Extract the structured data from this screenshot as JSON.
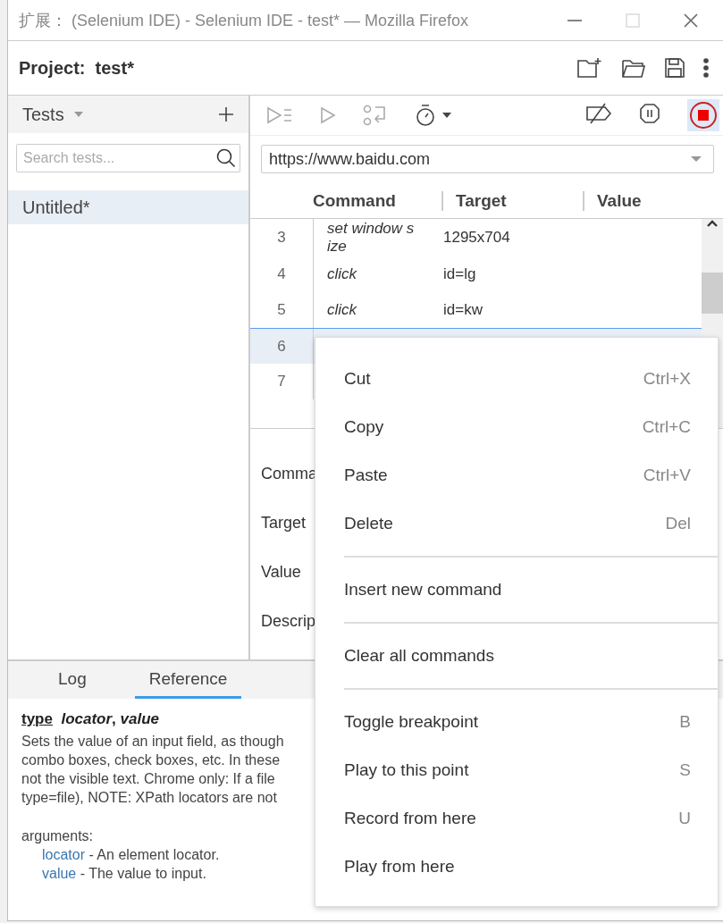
{
  "window": {
    "title": "扩展： (Selenium IDE) - Selenium IDE - test* — Mozilla Firefox"
  },
  "project": {
    "label": "Project:",
    "name": "test*"
  },
  "sidebar": {
    "title": "Tests",
    "search": {
      "placeholder": "Search tests..."
    },
    "items": [
      {
        "label": "Untitled*",
        "selected": true
      }
    ]
  },
  "url": {
    "value": "https://www.baidu.com"
  },
  "table": {
    "columns": [
      "Command",
      "Target",
      "Value"
    ],
    "rows": [
      {
        "index": "3",
        "command": "set window s ize",
        "target": "1295x704",
        "selected": false
      },
      {
        "index": "4",
        "command": "click",
        "target": "id=lg",
        "selected": false
      },
      {
        "index": "5",
        "command": "click",
        "target": "id=kw",
        "selected": false
      },
      {
        "index": "6",
        "command": "",
        "target": "",
        "selected": true
      },
      {
        "index": "7",
        "command": "",
        "target": "",
        "selected": false
      }
    ]
  },
  "editor": {
    "labels": [
      "Comma",
      "Target",
      "Value",
      "Descrip"
    ]
  },
  "bottom_tabs": [
    {
      "label": "Log",
      "selected": false
    },
    {
      "label": "Reference",
      "selected": true
    }
  ],
  "reference": {
    "command": "type",
    "arguments_line": "*locator*, *value*",
    "description_lines": [
      "Sets the value of an input field, as though",
      "combo boxes, check boxes, etc. In these",
      "not the visible text. Chrome only: If a file",
      "type=file), NOTE: XPath locators are not"
    ],
    "arguments_title": "arguments:",
    "arguments": [
      {
        "name": "locator",
        "text": "- An element locator."
      },
      {
        "name": "value",
        "text": "- The value to input."
      }
    ]
  },
  "context_menu": {
    "groups": [
      [
        {
          "label": "Cut",
          "shortcut": "Ctrl+X"
        },
        {
          "label": "Copy",
          "shortcut": "Ctrl+C"
        },
        {
          "label": "Paste",
          "shortcut": "Ctrl+V"
        },
        {
          "label": "Delete",
          "shortcut": "Del"
        }
      ],
      [
        {
          "label": "Insert new command"
        }
      ],
      [
        {
          "label": "Clear all commands"
        }
      ],
      [
        {
          "label": "Toggle breakpoint",
          "shortcut": "B"
        },
        {
          "label": "Play to this point",
          "shortcut": "S"
        },
        {
          "label": "Record from here",
          "shortcut": "U"
        },
        {
          "label": "Play from here"
        }
      ]
    ]
  }
}
